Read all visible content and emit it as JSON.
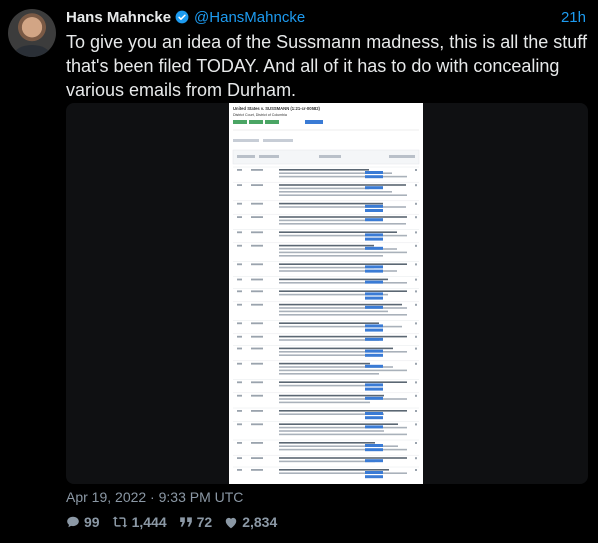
{
  "author": {
    "name": "Hans Mahncke",
    "handle": "@HansMahncke",
    "verified": true
  },
  "tweet": {
    "relative_time": "21h",
    "text": "To give you an idea of the Sussmann madness, this is all the stuff that's been filed TODAY. And all of it has to do with concealing various emails from Durham.",
    "timestamp": "Apr 19, 2022 · 9:33 PM UTC"
  },
  "media": {
    "doc_title": "United States v. SUSSMANN (1:21-cr-00582)",
    "doc_court": "District Court, District of Columbia"
  },
  "stats": {
    "replies": "99",
    "retweets": "1,444",
    "quotes": "72",
    "likes": "2,834"
  },
  "icons": {
    "reply": "reply-icon",
    "retweet": "retweet-icon",
    "quote": "quote-icon",
    "like": "heart-icon",
    "verified": "verified-badge-icon"
  },
  "colors": {
    "background": "#000000",
    "text": "#e7e9ea",
    "link": "#1d9bf0",
    "muted": "#8b98a5",
    "doc_button": "#3a7bd5"
  }
}
